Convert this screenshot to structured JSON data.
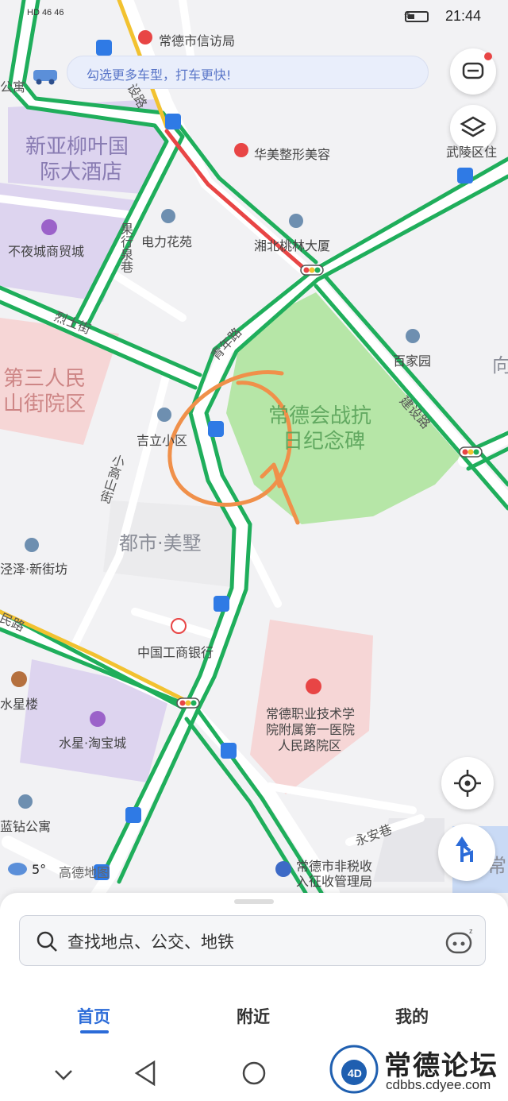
{
  "status_bar": {
    "signal_text": "HD 46 46",
    "time": "21:44"
  },
  "banner": {
    "text": "勾选更多车型，打车更快!"
  },
  "map_labels": {
    "xinfang": "常德市信访局",
    "gongyu": "公寓",
    "jianshelu_top": "设路",
    "xinya": "新亚柳叶国",
    "jiudian": "际大酒店",
    "huamei": "华美整形美容",
    "wuling": "武陵区住",
    "buyecheng": "不夜城商贸城",
    "dianli": "电力花苑",
    "xiangbei": "湘北桃林大厦",
    "guoxingquan": "果行泉巷",
    "lieshijie": "烈士街",
    "qingnianlu": "青年路",
    "baijiayuan": "百家园",
    "xiang": "向",
    "disan": "第三人民",
    "shanjie": "山街院区",
    "changdehui": "常德会战抗",
    "rijinian": "日纪念碑",
    "jianshelu": "建设路",
    "jili": "吉立小区",
    "xiaogaoshan": "小高山街",
    "dushi": "都市·美墅",
    "jingze": "泾泽·新街坊",
    "minlu": "民路",
    "icbc": "中国工商银行",
    "shuixinglou": "水星楼",
    "shuixing": "水星·淘宝城",
    "zhiye1": "常德职业技术学",
    "zhiye2": "院附属第一医院",
    "zhiye3": "人民路院区",
    "lanzuan": "蓝钻公寓",
    "yonganxiang": "永安巷",
    "feishui1": "常德市非税收",
    "feishui2": "入征收管理局",
    "temp": "5°",
    "gaode": "高德地图",
    "chang": "常"
  },
  "icons": {
    "message": "message-icon",
    "layers": "layers-icon",
    "locate": "locate-icon",
    "route": "route-icon",
    "search": "search-icon",
    "assistant": "robot-icon"
  },
  "search": {
    "placeholder": "查找地点、公交、地铁"
  },
  "tabs": [
    {
      "label": "首页",
      "active": true
    },
    {
      "label": "附近",
      "active": false
    },
    {
      "label": "我的",
      "active": false
    }
  ],
  "watermark": {
    "title": "常德论坛",
    "url": "cdbbs.cdyee.com"
  },
  "colors": {
    "road_green": "#1fae5b",
    "road_red": "#e84545",
    "road_yellow": "#f2c230",
    "park": "#b6e6a7",
    "accent": "#2b6bd8"
  }
}
